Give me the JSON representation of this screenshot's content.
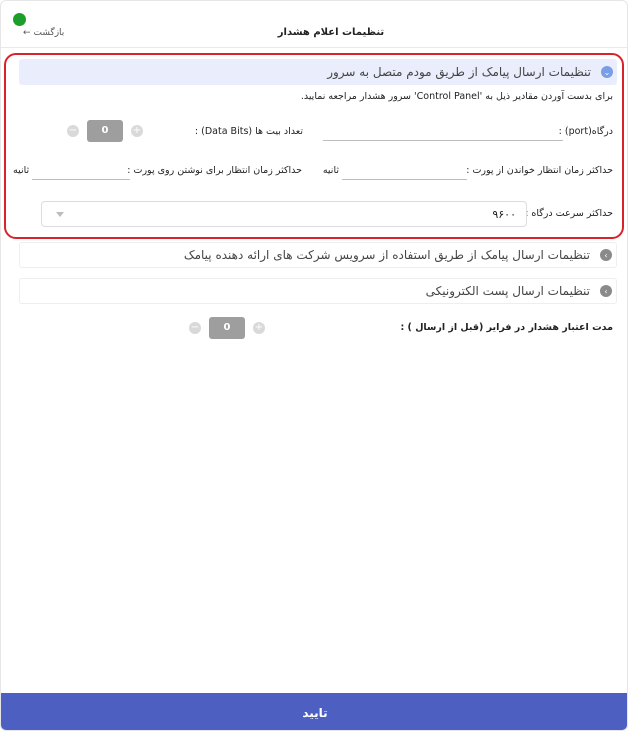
{
  "header": {
    "title": "تنظیمات اعلام هشدار",
    "back_label": "بازگشت",
    "back_arrow": "←",
    "status_color": "#1f9d2a"
  },
  "sections": {
    "sms_modem": {
      "title": "تنظیمات ارسال پیامک از طریق مودم متصل به سرور",
      "note": "برای بدست آوردن مقادیر ذیل به 'Control Panel' سرور هشدار مراجعه نمایید.",
      "port_label": "درگاه(port) :",
      "data_bits_label": "تعداد بیت ها (Data Bits) :",
      "data_bits_value": "0",
      "read_timeout_label": "حداکثر زمان انتظار خواندن از پورت :",
      "read_timeout_unit": "ثانیه",
      "write_timeout_label": "حداکثر زمان انتظار برای نوشتن روی پورت :",
      "write_timeout_unit": "ثانیه",
      "baud_label": "حداکثر سرعت درگاه :",
      "baud_value": "۹۶۰۰"
    },
    "sms_service": {
      "title": "تنظیمات ارسال پیامک از طریق استفاده از سرویس شرکت های ارائه دهنده پیامک"
    },
    "email": {
      "title": "تنظیمات ارسال پست الکترونیکی"
    }
  },
  "validity": {
    "label": "مدت اعتبار هشدار در فرایر (قبل از ارسال ) :",
    "value": "0"
  },
  "footer": {
    "confirm_label": "تایید",
    "color": "#4d5fc1"
  },
  "icons": {
    "minus": "−",
    "plus": "+",
    "chevron_down": "⌄",
    "chevron_right": "›"
  }
}
